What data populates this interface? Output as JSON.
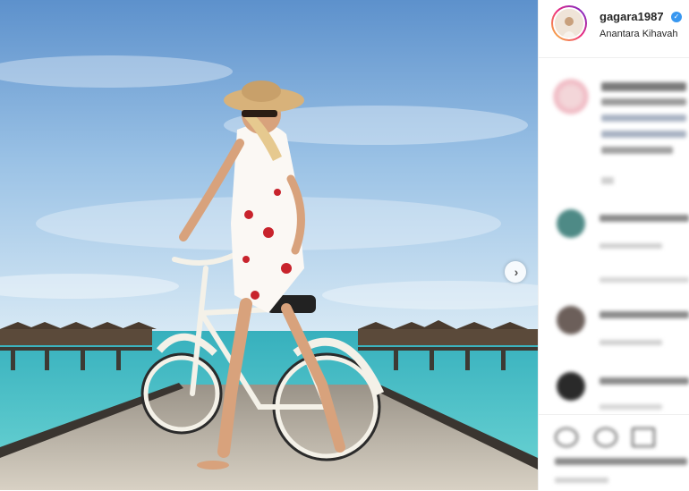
{
  "post": {
    "username": "gagara1987",
    "location": "Anantara Kihavah",
    "verified": true
  },
  "icons": {
    "next": "chevron-right-icon",
    "verified": "verified-badge-icon",
    "like": "heart-icon",
    "comment": "comment-icon",
    "share": "share-icon"
  },
  "colors": {
    "sky_top": "#6a9bd0",
    "sea": "#48c0c8",
    "verified_blue": "#3897f0"
  }
}
